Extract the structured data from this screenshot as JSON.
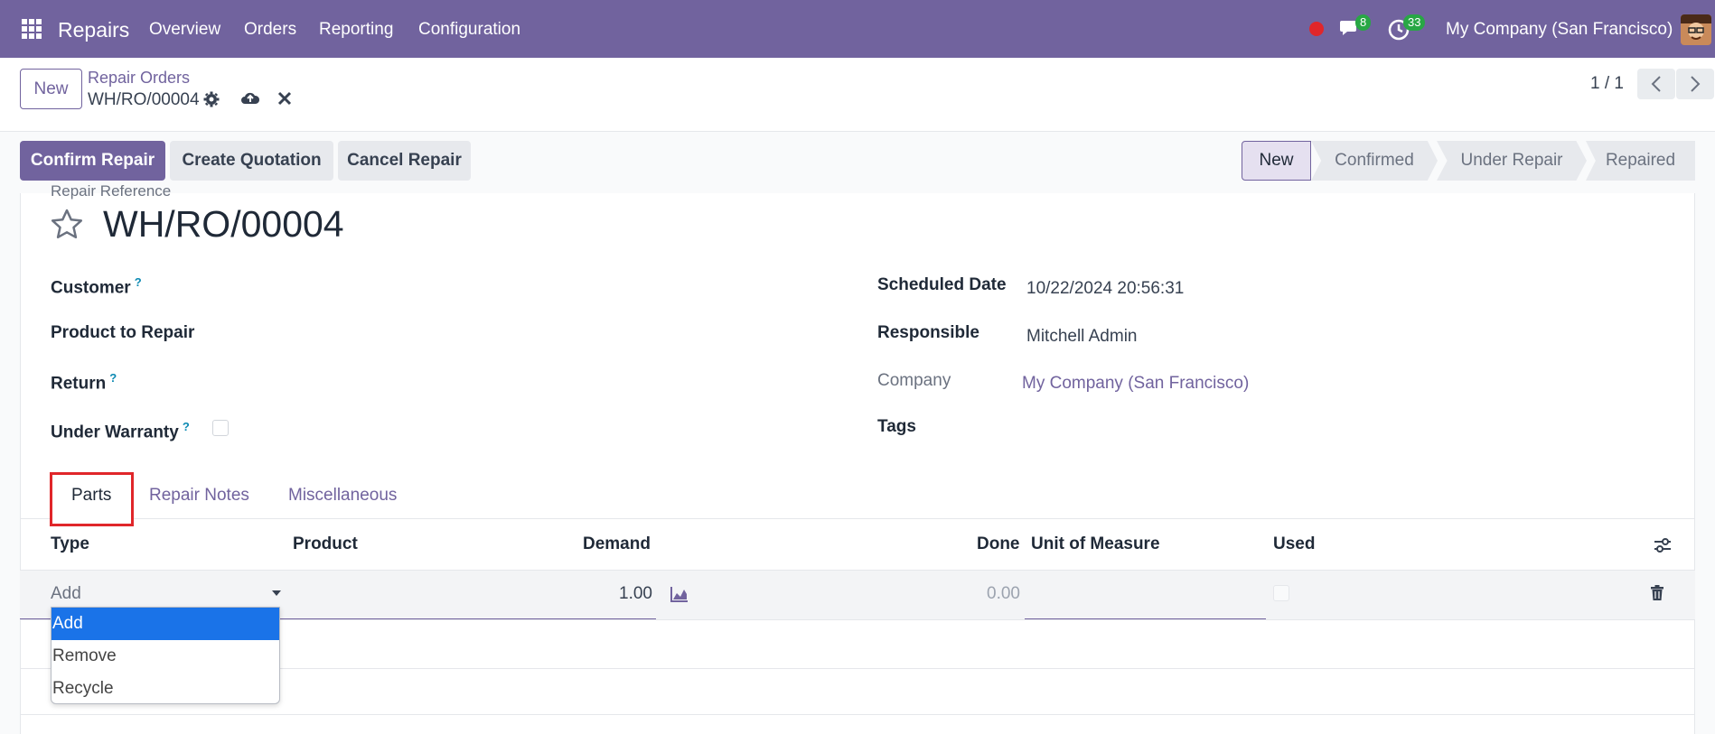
{
  "navbar": {
    "app_name": "Repairs",
    "menu": [
      "Overview",
      "Orders",
      "Reporting",
      "Configuration"
    ],
    "chat_count": "8",
    "activity_count": "33",
    "company": "My Company (San Francisco)"
  },
  "control": {
    "new_label": "New",
    "breadcrumb_parent": "Repair Orders",
    "breadcrumb_current": "WH/RO/00004",
    "pager": "1 / 1"
  },
  "actions": {
    "confirm": "Confirm Repair",
    "quotation": "Create Quotation",
    "cancel": "Cancel Repair"
  },
  "status": [
    "New",
    "Confirmed",
    "Under Repair",
    "Repaired"
  ],
  "form": {
    "ref_label": "Repair Reference",
    "title": "WH/RO/00004",
    "customer_label": "Customer",
    "product_label": "Product to Repair",
    "return_label": "Return",
    "warranty_label": "Under Warranty",
    "scheduled_label": "Scheduled Date",
    "scheduled_value": "10/22/2024 20:56:31",
    "responsible_label": "Responsible",
    "responsible_value": "Mitchell Admin",
    "company_label": "Company",
    "company_value": "My Company (San Francisco)",
    "tags_label": "Tags",
    "help_mark": "?"
  },
  "tabs": [
    "Parts",
    "Repair Notes",
    "Miscellaneous"
  ],
  "table": {
    "headers": [
      "Type",
      "Product",
      "Demand",
      "Done",
      "Unit of Measure",
      "Used"
    ],
    "row": {
      "type": "Add",
      "demand": "1.00",
      "done": "0.00"
    }
  },
  "dropdown": {
    "options": [
      "Add",
      "Remove",
      "Recycle"
    ],
    "selected": "Add"
  },
  "colors": {
    "brand": "#71639e",
    "highlight": "#e0262a",
    "selected": "#1a73e8"
  }
}
